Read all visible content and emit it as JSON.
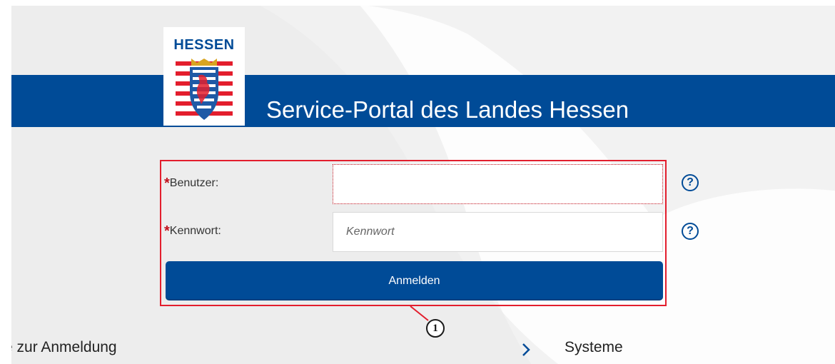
{
  "header": {
    "logo_text": "HESSEN",
    "portal_title": "Service-Portal des Landes Hessen"
  },
  "login_form": {
    "required_marker": "*",
    "username_label": "Benutzer:",
    "username_value": "",
    "password_label": "Kennwort:",
    "password_placeholder": "Kennwort",
    "help_glyph": "?",
    "submit_label": "Anmelden",
    "callout_number": "1"
  },
  "footer_links": {
    "left_link": "e zur Anmeldung",
    "right_link": "Systeme"
  },
  "icons": {
    "help": "question-circle-icon",
    "chevron": "chevron-right-icon",
    "coat_of_arms": "hessen-coat-of-arms"
  },
  "colors": {
    "banner_blue": "#004b97",
    "highlight_red": "#e31e2d",
    "required_red": "#c0131e"
  }
}
